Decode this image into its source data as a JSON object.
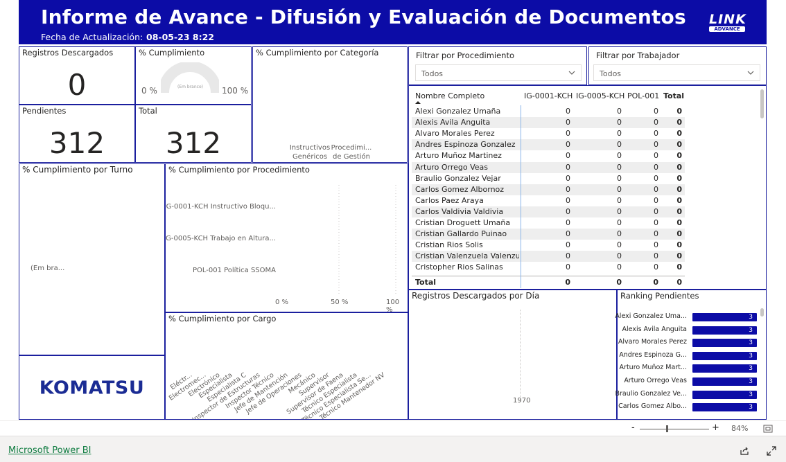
{
  "header": {
    "title": "Informe de Avance - Difusión y Evaluación de Documentos",
    "date_label": "Fecha de Actualización:",
    "date_value": "08-05-23 8:22",
    "logo_text": "LINK",
    "logo_sub": "ADVANCE"
  },
  "kpis": {
    "registros_title": "Registros Descargados",
    "registros_value": "0",
    "cumplimiento_title": "% Cumplimiento",
    "gauge_min": "0 %",
    "gauge_max": "100 %",
    "gauge_center": "(Em branco)",
    "pendientes_title": "Pendientes",
    "pendientes_value": "312",
    "total_title": "Total",
    "total_value": "312"
  },
  "categoria": {
    "title": "% Cumplimiento por Categoría",
    "cat1_l1": "Instructivos",
    "cat1_l2": "Genéricos",
    "cat2_l1": "Procedimi...",
    "cat2_l2": "de Gestión"
  },
  "slicers": {
    "procedimiento_title": "Filtrar por Procedimiento",
    "procedimiento_value": "Todos",
    "trabajador_title": "Filtrar por Trabajador",
    "trabajador_value": "Todos"
  },
  "turno": {
    "title": "% Cumplimiento por Turno",
    "blank": "(Em bra..."
  },
  "procedimiento_chart": {
    "title": "% Cumplimiento por Procedimiento",
    "items": [
      "IG-0001-KCH Instructivo Bloqu...",
      "IG-0005-KCH Trabajo en Altura...",
      "POL-001 Política SSOMA"
    ],
    "ticks": [
      "0 %",
      "50 %",
      "100 %"
    ]
  },
  "cargo_chart": {
    "title": "% Cumplimiento por Cargo",
    "labels": [
      "Eléctr...",
      "Electromec...",
      "Electrónico",
      "Especialista",
      "Especialista C",
      "Inspector de Estructuras",
      "Inspector Técnico",
      "Jefe de Mantención",
      "Jefe de Operaciones",
      "Mecánico",
      "Supervisor",
      "Supervisor de Faena",
      "Técnico Especialista",
      "Técnico Especialista Se...",
      "Técnico Mantenedor NV"
    ]
  },
  "company_logo": "KOMATSU",
  "table": {
    "headers": [
      "Nombre Completo",
      "IG-0001-KCH",
      "IG-0005-KCH",
      "POL-001",
      "Total"
    ],
    "rows": [
      [
        "Alexi Gonzalez Umaña",
        "0",
        "0",
        "0",
        "0"
      ],
      [
        "Alexis Avila Anguita",
        "0",
        "0",
        "0",
        "0"
      ],
      [
        "Alvaro Morales Perez",
        "0",
        "0",
        "0",
        "0"
      ],
      [
        "Andres Espinoza Gonzalez",
        "0",
        "0",
        "0",
        "0"
      ],
      [
        "Arturo Muñoz Martinez",
        "0",
        "0",
        "0",
        "0"
      ],
      [
        "Arturo Orrego Veas",
        "0",
        "0",
        "0",
        "0"
      ],
      [
        "Braulio Gonzalez Vejar",
        "0",
        "0",
        "0",
        "0"
      ],
      [
        "Carlos Gomez Albornoz",
        "0",
        "0",
        "0",
        "0"
      ],
      [
        "Carlos Paez Araya",
        "0",
        "0",
        "0",
        "0"
      ],
      [
        "Carlos Valdivia Valdivia",
        "0",
        "0",
        "0",
        "0"
      ],
      [
        "Cristian Droguett Umaña",
        "0",
        "0",
        "0",
        "0"
      ],
      [
        "Cristian Gallardo Puinao",
        "0",
        "0",
        "0",
        "0"
      ],
      [
        "Cristian Rios Solis",
        "0",
        "0",
        "0",
        "0"
      ],
      [
        "Cristian Valenzuela Valenzuela",
        "0",
        "0",
        "0",
        "0"
      ],
      [
        "Cristopher Rios Salinas",
        "0",
        "0",
        "0",
        "0"
      ]
    ],
    "total_row": [
      "Total",
      "0",
      "0",
      "0",
      "0"
    ]
  },
  "registros_dia": {
    "title": "Registros Descargados por Día",
    "axis_label": "1970"
  },
  "ranking": {
    "title": "Ranking Pendientes",
    "items": [
      {
        "name": "Alexi Gonzalez Uma...",
        "value": "3"
      },
      {
        "name": "Alexis Avila Anguita",
        "value": "3"
      },
      {
        "name": "Alvaro Morales Perez",
        "value": "3"
      },
      {
        "name": "Andres Espinoza G...",
        "value": "3"
      },
      {
        "name": "Arturo Muñoz Mart...",
        "value": "3"
      },
      {
        "name": "Arturo Orrego Veas",
        "value": "3"
      },
      {
        "name": "Braulio Gonzalez Ve...",
        "value": "3"
      },
      {
        "name": "Carlos Gomez Albo...",
        "value": "3"
      }
    ]
  },
  "zoom": {
    "minus": "-",
    "plus": "+",
    "level": "84%"
  },
  "footer": {
    "link": "Microsoft Power BI"
  },
  "colors": {
    "brand_blue": "#0c0ca6",
    "border_blue": "#1b1f9e",
    "komatsu_blue": "#1b2c94"
  }
}
